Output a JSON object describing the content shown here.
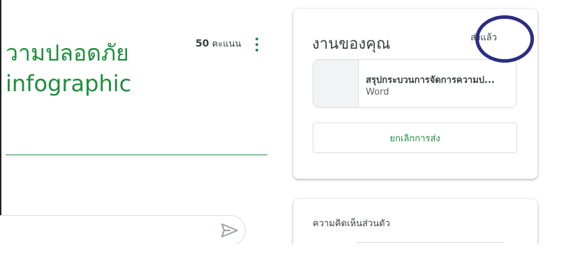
{
  "assignment": {
    "title_line1": "วามปลอดภัย",
    "title_line2": "infographic",
    "points_value": "50",
    "points_unit": "คะแนน"
  },
  "your_work": {
    "title": "งานของคุณ",
    "status": "ส่งแล้ว",
    "attachment": {
      "name": "สรุปกระบวนการจัดการความป...",
      "type": "Word"
    },
    "unsubmit_label": "ยกเลิกการส่ง"
  },
  "private_comments": {
    "title": "ความคิดเห็นส่วนตัว"
  },
  "icons": {
    "more": "more-vert-icon",
    "send": "send-icon"
  },
  "colors": {
    "accent": "#1e8e3e",
    "annotation_circle": "#2b2d84"
  }
}
